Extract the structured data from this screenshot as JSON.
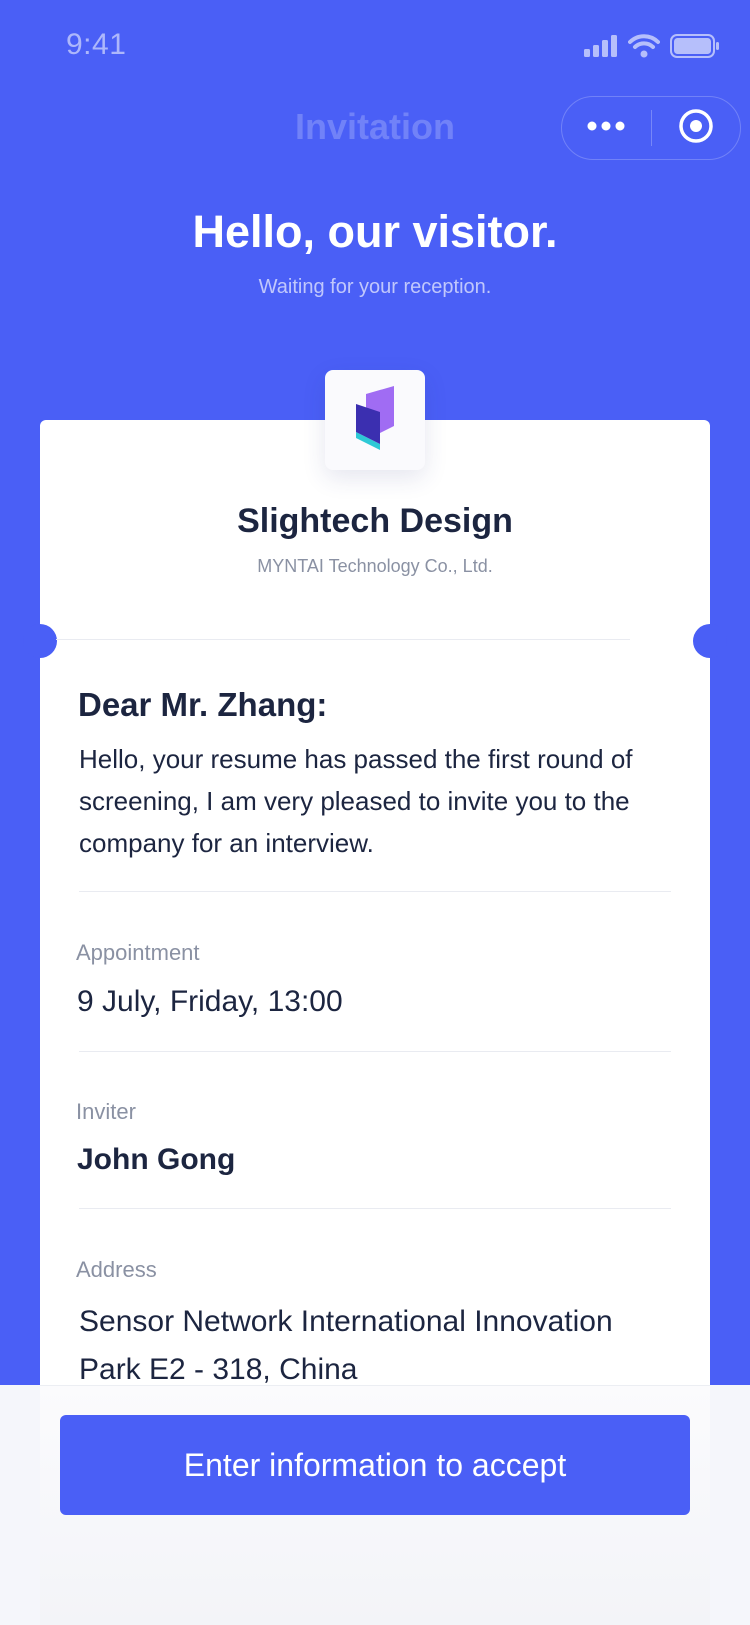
{
  "status_bar": {
    "time": "9:41"
  },
  "nav": {
    "title": "Invitation"
  },
  "header": {
    "greeting": "Hello, our visitor.",
    "subtitle": "Waiting for your reception."
  },
  "company": {
    "name": "Slightech Design",
    "legal_name": "MYNTAI Technology Co., Ltd."
  },
  "letter": {
    "salutation": "Dear Mr. Zhang:",
    "body": "Hello, your resume has passed the first round of screening, I am very pleased to invite you to the company for an interview."
  },
  "details": {
    "appointment_label": "Appointment",
    "appointment_value": "9 July, Friday, 13:00",
    "inviter_label": "Inviter",
    "inviter_value": "John Gong",
    "address_label": "Address",
    "address_value": "Sensor Network International Innovation Park E2 - 318, China"
  },
  "actions": {
    "accept_label": "Enter information to accept"
  },
  "colors": {
    "brand": "#4a5ff6",
    "text_primary": "#1c2540",
    "text_secondary": "#8a91a3"
  },
  "icons": [
    "signal-icon",
    "wifi-icon",
    "battery-icon",
    "more-icon",
    "close-target-icon",
    "company-logo-icon"
  ]
}
